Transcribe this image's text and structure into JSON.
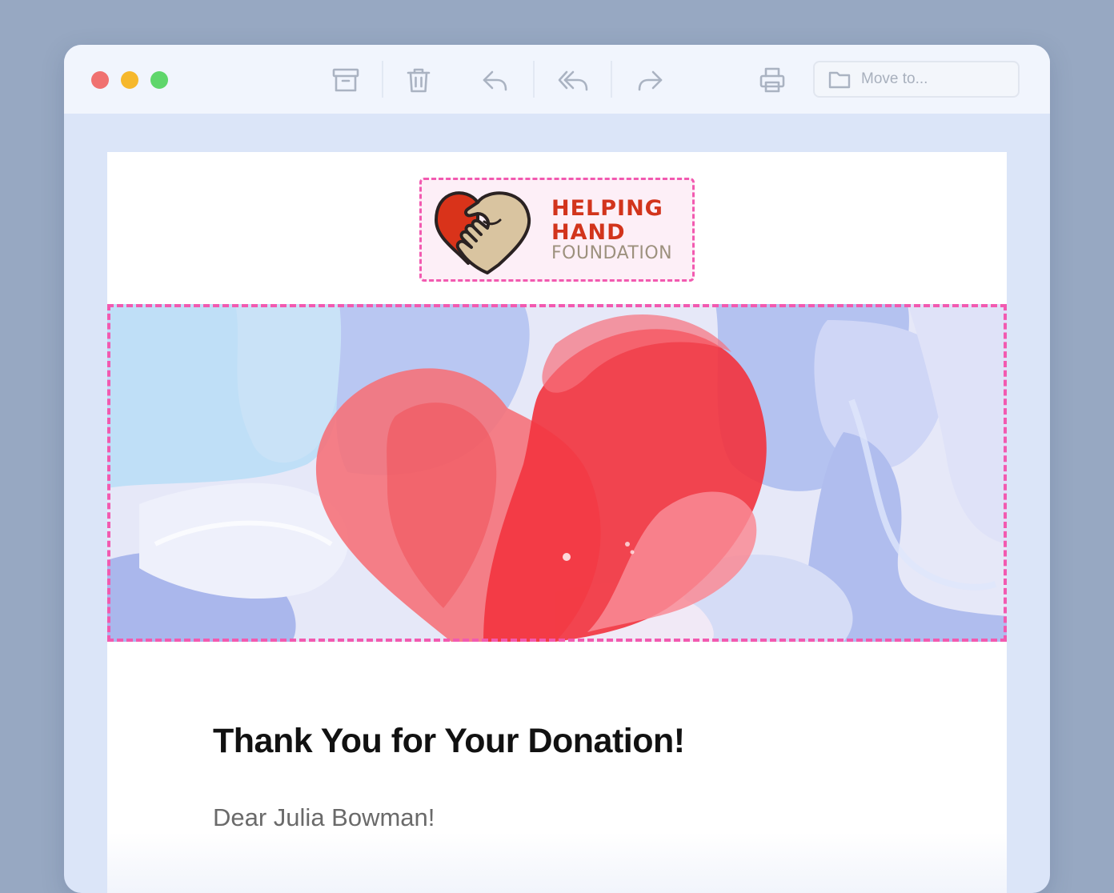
{
  "window": {
    "traffic_lights": {
      "close": "#f07170",
      "minimize": "#f6b82c",
      "maximize": "#5fd66b"
    }
  },
  "toolbar": {
    "icons": [
      "archive-icon",
      "trash-icon",
      "reply-icon",
      "reply-all-icon",
      "forward-icon",
      "print-icon"
    ],
    "move_to": {
      "icon": "folder-icon",
      "placeholder": "Move to..."
    }
  },
  "email": {
    "logo": {
      "line1": "HELPING",
      "line2": "HAND",
      "line3": "FOUNDATION",
      "colors": {
        "brand_red": "#d2341c",
        "brand_tan": "#9d917e"
      }
    },
    "hero": {
      "image": "painted-heart-illustration",
      "accent": "#f0303c"
    },
    "headline": "Thank You for Your Donation!",
    "greeting": "Dear Julia Bowman!"
  },
  "colors": {
    "selection_dash": "#f25ab0",
    "canvas": "#dbe5f8",
    "page_bg": "#97a8c2"
  }
}
